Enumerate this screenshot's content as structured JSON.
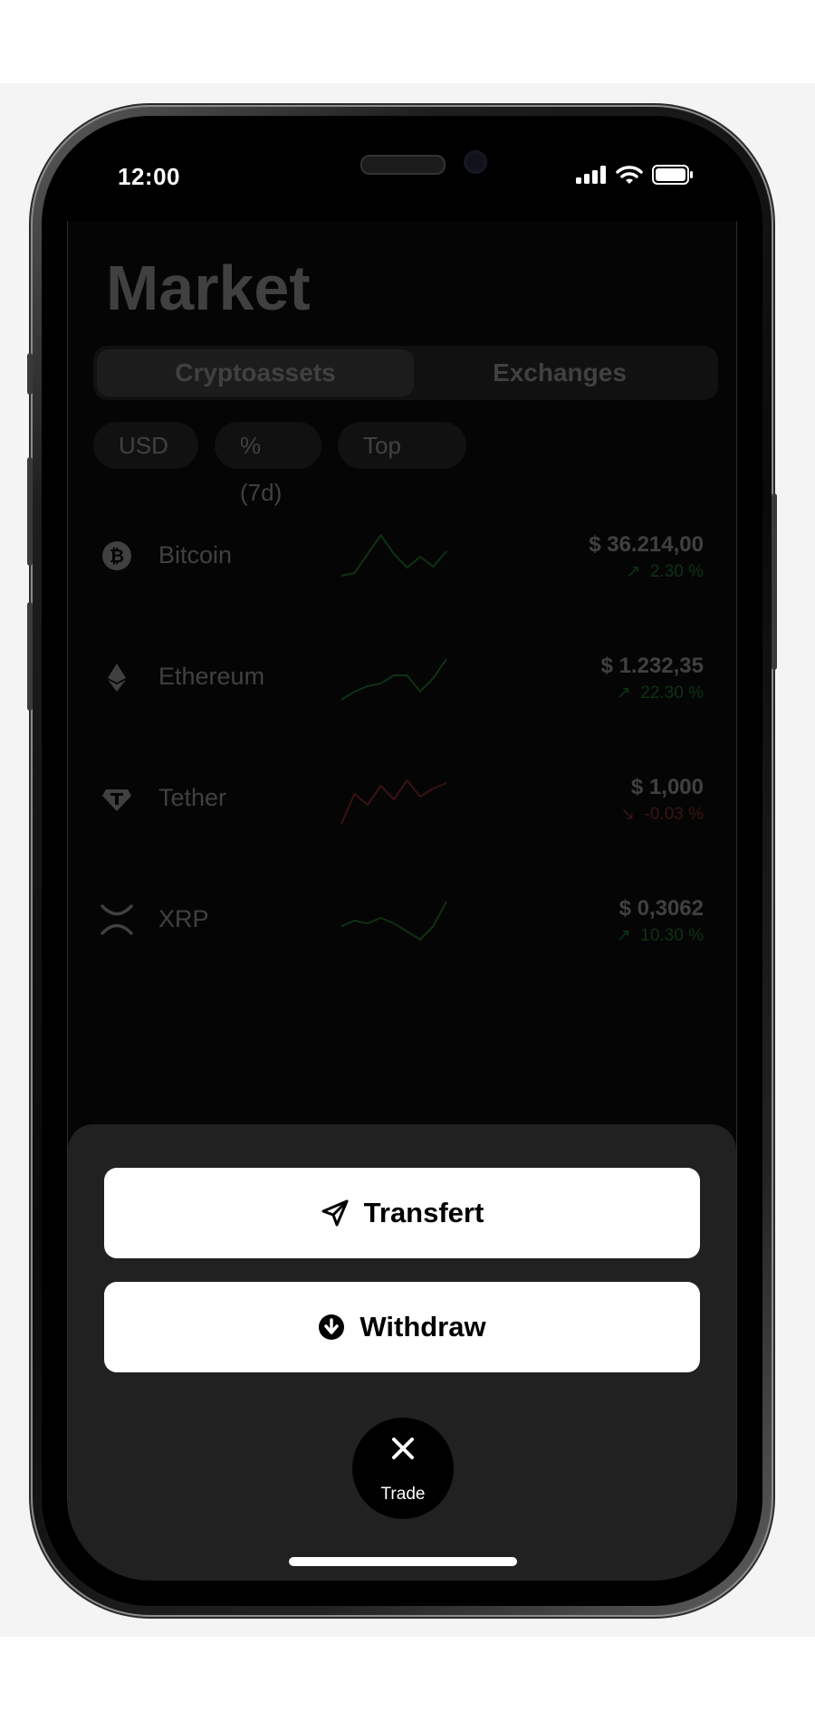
{
  "status_bar": {
    "time": "12:00"
  },
  "market": {
    "title": "Market",
    "tabs": [
      {
        "label": "Cryptoassets",
        "active": true
      },
      {
        "label": "Exchanges",
        "active": false
      }
    ],
    "filters": [
      {
        "label": "USD"
      },
      {
        "label": "% (7d)"
      },
      {
        "label": "Top"
      }
    ],
    "coins": [
      {
        "name": "Bitcoin",
        "icon": "bitcoin-icon",
        "price": "$ 36.214,00",
        "change": "2.30 %",
        "direction": "up",
        "trend": [
          0.15,
          0.2,
          0.55,
          0.9,
          0.55,
          0.3,
          0.5,
          0.32,
          0.6
        ]
      },
      {
        "name": "Ethereum",
        "icon": "ethereum-icon",
        "price": "$ 1.232,35",
        "change": "22.30 %",
        "direction": "up",
        "trend": [
          0.1,
          0.25,
          0.35,
          0.4,
          0.55,
          0.55,
          0.25,
          0.5,
          0.85
        ]
      },
      {
        "name": "Tether",
        "icon": "tether-icon",
        "price": "$ 1,000",
        "change": "-0.03 %",
        "direction": "down",
        "trend": [
          0.05,
          0.6,
          0.4,
          0.75,
          0.5,
          0.85,
          0.55,
          0.7,
          0.8
        ]
      },
      {
        "name": "XRP",
        "icon": "xrp-icon",
        "price": "$ 0,3062",
        "change": "10.30 %",
        "direction": "up",
        "trend": [
          0.4,
          0.5,
          0.45,
          0.55,
          0.45,
          0.3,
          0.15,
          0.4,
          0.85
        ]
      }
    ]
  },
  "sheet": {
    "transfer_label": "Transfert",
    "withdraw_label": "Withdraw",
    "trade_label": "Trade"
  },
  "colors": {
    "up": "#2fbf4a",
    "down": "#e0443c",
    "sheet": "#212121"
  }
}
